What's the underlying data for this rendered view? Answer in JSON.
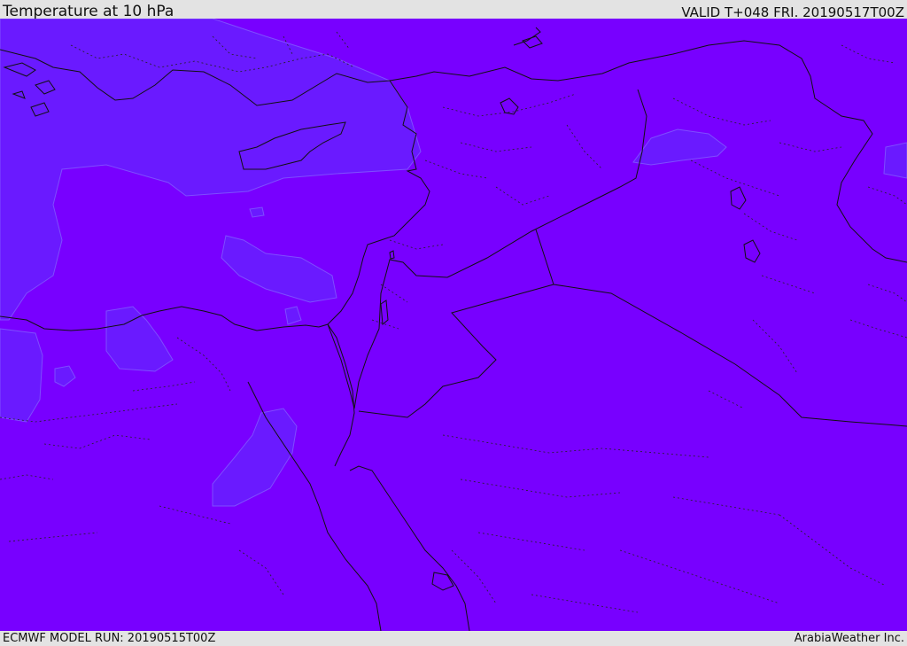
{
  "header": {
    "title": "Temperature at 10 hPa",
    "valid": "VALID T+048 FRI. 20190517T00Z"
  },
  "footer": {
    "model_run": "ECMWF MODEL RUN: 20190515T00Z",
    "credit": "ArabiaWeather Inc."
  },
  "map": {
    "field": "temperature",
    "level": "10 hPa",
    "colors": {
      "background_field": "#7800ff",
      "colder_field": "#6a1aff",
      "coast_lines": "#111111",
      "border_lines": "#1a1a1a"
    }
  }
}
